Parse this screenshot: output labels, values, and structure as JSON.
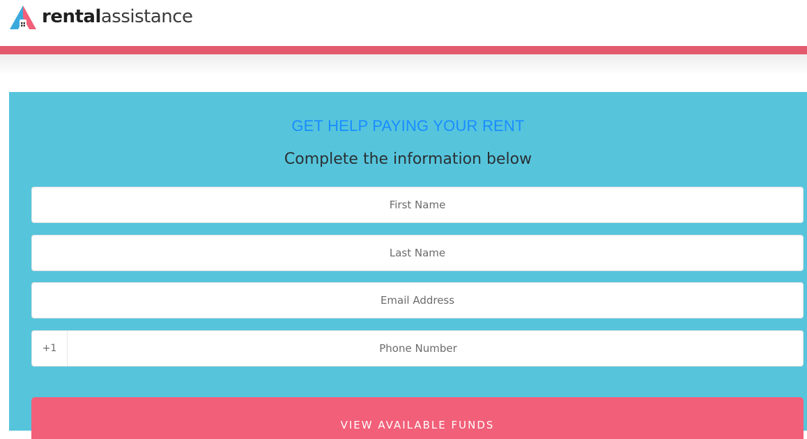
{
  "header": {
    "brand": {
      "bold": "rental",
      "light": "assistance"
    },
    "colors": {
      "accent_bar": "#e35a6f",
      "logo_blue": "#3aa9dc",
      "logo_coral": "#f25f78"
    }
  },
  "form": {
    "title": "GET HELP PAYING YOUR RENT",
    "subtitle": "Complete the information below",
    "fields": {
      "first_name": {
        "placeholder": "First Name",
        "value": ""
      },
      "last_name": {
        "placeholder": "Last Name",
        "value": ""
      },
      "email": {
        "placeholder": "Email Address",
        "value": ""
      },
      "phone": {
        "prefix": "+1",
        "placeholder": "Phone Number",
        "value": ""
      }
    },
    "submit_label": "VIEW AVAILABLE FUNDS",
    "colors": {
      "panel_bg": "#56c5dc",
      "title": "#1a8cff",
      "button_bg": "#f25f78"
    }
  }
}
